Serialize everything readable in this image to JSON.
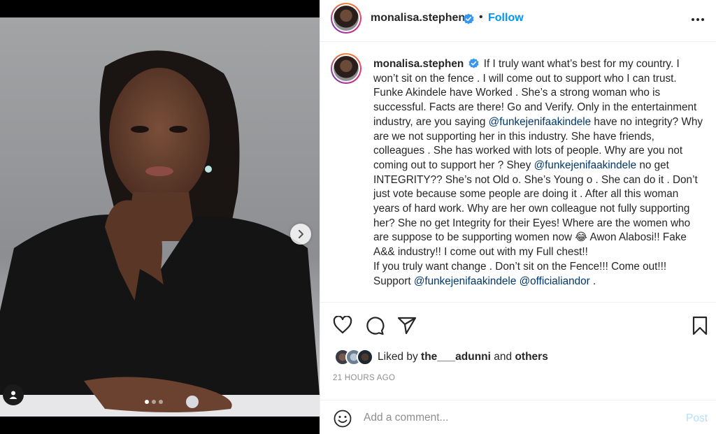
{
  "post": {
    "username": "monalisa.stephen",
    "verified": true,
    "bullet": "•",
    "follow_label": "Follow",
    "more_icon": "more-horizontal-icon"
  },
  "caption": {
    "username": "monalisa.stephen",
    "parts": [
      {
        "type": "text",
        "value": " If I truly want what’s best for my country. I won’t sit on the fence . I will come out to support who I can trust. Funke Akindele have Worked . She’s a strong woman who is successful. Facts are there! Go and Verify. Only in the entertainment industry, are you saying "
      },
      {
        "type": "mention",
        "value": "@funkejenifaakindele"
      },
      {
        "type": "text",
        "value": " have no integrity? Why are we not supporting her in this industry. She have friends, colleagues . She has worked with lots of people. Why are you not coming out to support her ? Shey "
      },
      {
        "type": "mention",
        "value": "@funkejenifaakindele"
      },
      {
        "type": "text",
        "value": " no get INTEGRITY?? She’s not Old o. She’s Young o . She can do it . Don’t just vote because some people are doing it . After all this woman years of hard work. Why are her own colleague not fully supporting her? She no get Integrity for their Eyes! Where are the women who are suppose to be supporting women now 😂 Awon Alabosi!! Fake A&& industry!! I come out with my Full chest!!"
      },
      {
        "type": "break"
      },
      {
        "type": "text",
        "value": "If you truly want change . Don’t sit on the Fence!!! Come out!!! Support "
      },
      {
        "type": "mention",
        "value": "@funkejenifaakindele"
      },
      {
        "type": "text",
        "value": " "
      },
      {
        "type": "mention",
        "value": "@officialiandor"
      },
      {
        "type": "text",
        "value": " ."
      }
    ]
  },
  "actions": {
    "like_icon": "heart-icon",
    "comment_icon": "comment-icon",
    "share_icon": "send-icon",
    "save_icon": "bookmark-icon"
  },
  "likes": {
    "prefix": "Liked by ",
    "user": "the___adunni",
    "middle": " and ",
    "others": "others"
  },
  "timestamp": "21 HOURS AGO",
  "comment": {
    "placeholder": "Add a comment...",
    "post_label": "Post",
    "emoji_icon": "smiley-icon"
  },
  "carousel": {
    "total": 3,
    "current": 1,
    "next_icon": "chevron-right-icon",
    "tag_icon": "user-tag-icon"
  },
  "colors": {
    "accent": "#0095f6",
    "mention": "#00376b",
    "muted": "#8e8e8e",
    "post_disabled": "#b2dffc"
  }
}
